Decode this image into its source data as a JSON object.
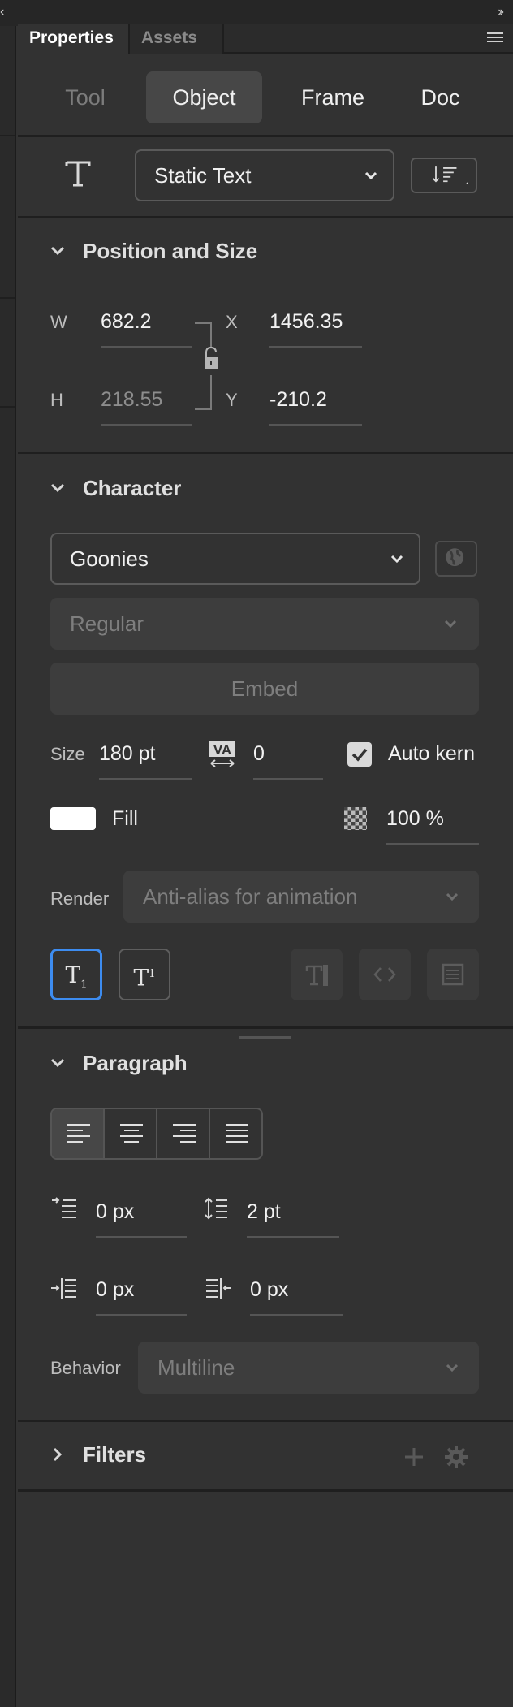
{
  "panel": {
    "tabs": [
      {
        "label": "Properties",
        "active": true
      },
      {
        "label": "Assets",
        "active": false
      }
    ],
    "modes": [
      "Tool",
      "Object",
      "Frame",
      "Doc"
    ],
    "active_mode": "Object",
    "text_type": "Static Text"
  },
  "position_size": {
    "title": "Position and Size",
    "w_label": "W",
    "w_value": "682.2",
    "h_label": "H",
    "h_value": "218.55",
    "x_label": "X",
    "x_value": "1456.35",
    "y_label": "Y",
    "y_value": "-210.2"
  },
  "character": {
    "title": "Character",
    "font": "Goonies",
    "style": "Regular",
    "embed_label": "Embed",
    "size_label": "Size",
    "size_value": "180 pt",
    "tracking_value": "0",
    "auto_kern_label": "Auto kern",
    "auto_kern_checked": true,
    "fill_label": "Fill",
    "fill_color": "#ffffff",
    "alpha_value": "100 %",
    "render_label": "Render",
    "render_value": "Anti-alias for animation"
  },
  "paragraph": {
    "title": "Paragraph",
    "align_options": [
      "left",
      "center",
      "right",
      "justify"
    ],
    "active_align": "left",
    "indent_value": "0 px",
    "line_spacing_value": "2 pt",
    "left_margin_value": "0 px",
    "right_margin_value": "0 px",
    "behavior_label": "Behavior",
    "behavior_value": "Multiline"
  },
  "filters": {
    "title": "Filters"
  },
  "colors": {
    "panel_bg": "#323232",
    "accent": "#3d8cf0"
  }
}
